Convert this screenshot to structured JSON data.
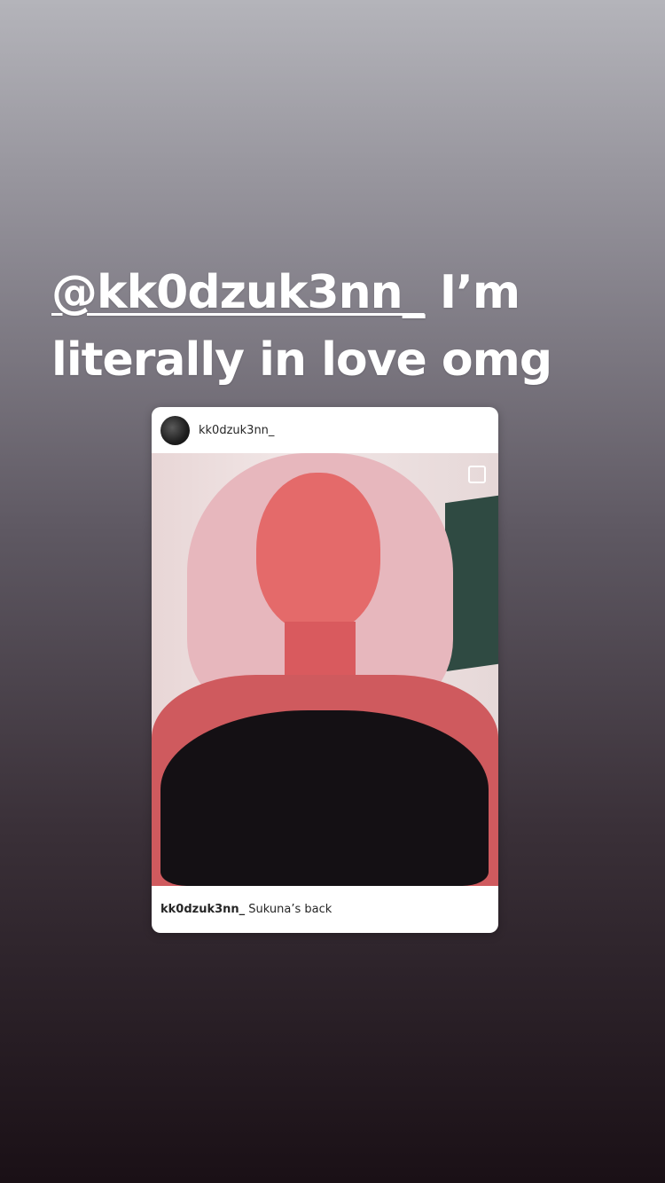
{
  "story": {
    "mention": "@kk0dzuk3nn_",
    "caption_rest_line1": " I’m",
    "caption_line2": "literally in love omg"
  },
  "post": {
    "username": "kk0dzuk3nn_",
    "caption_username": "kk0dzuk3nn_",
    "caption_text": " Sukuna’s back"
  },
  "colors": {
    "caption": "#ffffff",
    "card": "#ffffff",
    "text": "#262626"
  },
  "icons": {
    "save": "bookmark-icon"
  }
}
